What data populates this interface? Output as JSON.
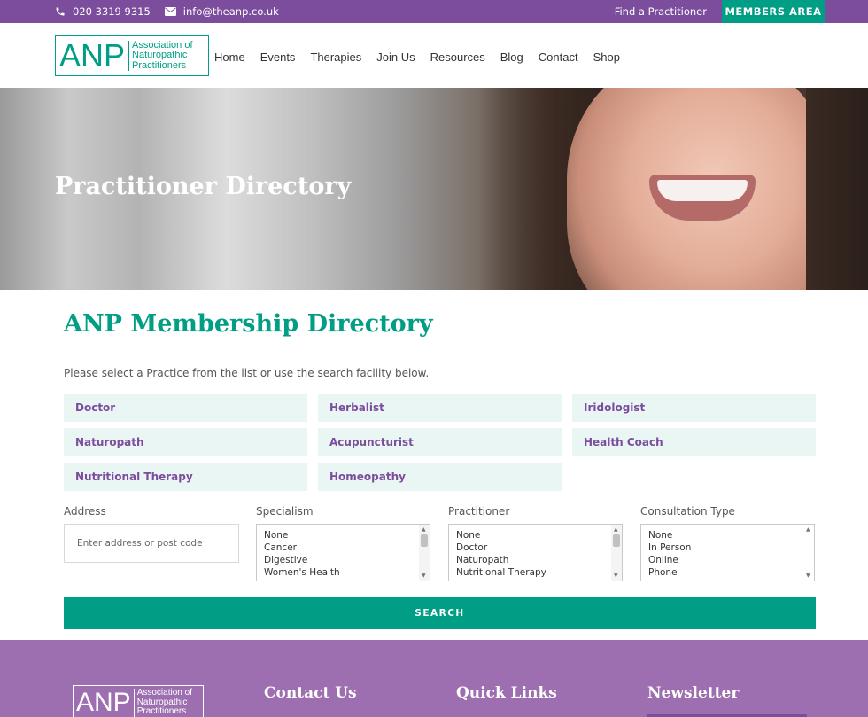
{
  "topbar": {
    "phone": "020 3319 9315",
    "email": "info@theanp.co.uk",
    "find_link": "Find a Practitioner",
    "members_button": "MEMBERS AREA"
  },
  "logo": {
    "abbr": "ANP",
    "line1": "Association of",
    "line2": "Naturopathic",
    "line3": "Practitioners"
  },
  "nav": [
    "Home",
    "Events",
    "Therapies",
    "Join Us",
    "Resources",
    "Blog",
    "Contact",
    "Shop"
  ],
  "hero": {
    "title": "Practitioner Directory"
  },
  "main": {
    "title": "ANP Membership Directory",
    "intro": "Please select a Practice from the list or use the search facility below."
  },
  "practices": [
    "Doctor",
    "Herbalist",
    "Iridologist",
    "Naturopath",
    "Acupuncturist",
    "Health Coach",
    "Nutritional Therapy",
    "Homeopathy"
  ],
  "search": {
    "address_label": "Address",
    "address_placeholder": "Enter address or post code",
    "specialism_label": "Specialism",
    "specialism_options": [
      "None",
      "Cancer",
      "Digestive",
      "Women's Health"
    ],
    "practitioner_label": "Practitioner",
    "practitioner_options": [
      "None",
      "Doctor",
      "Naturopath",
      "Nutritional Therapy"
    ],
    "consultation_label": "Consultation Type",
    "consultation_options": [
      "None",
      "In Person",
      "Online",
      "Phone"
    ],
    "button": "SEARCH"
  },
  "footer": {
    "contact_heading": "Contact Us",
    "links_heading": "Quick Links",
    "newsletter_heading": "Newsletter"
  },
  "colors": {
    "purple": "#7c4d9c",
    "teal": "#009e84",
    "footer": "#9d6fb0",
    "tile": "#eaf6f4"
  }
}
